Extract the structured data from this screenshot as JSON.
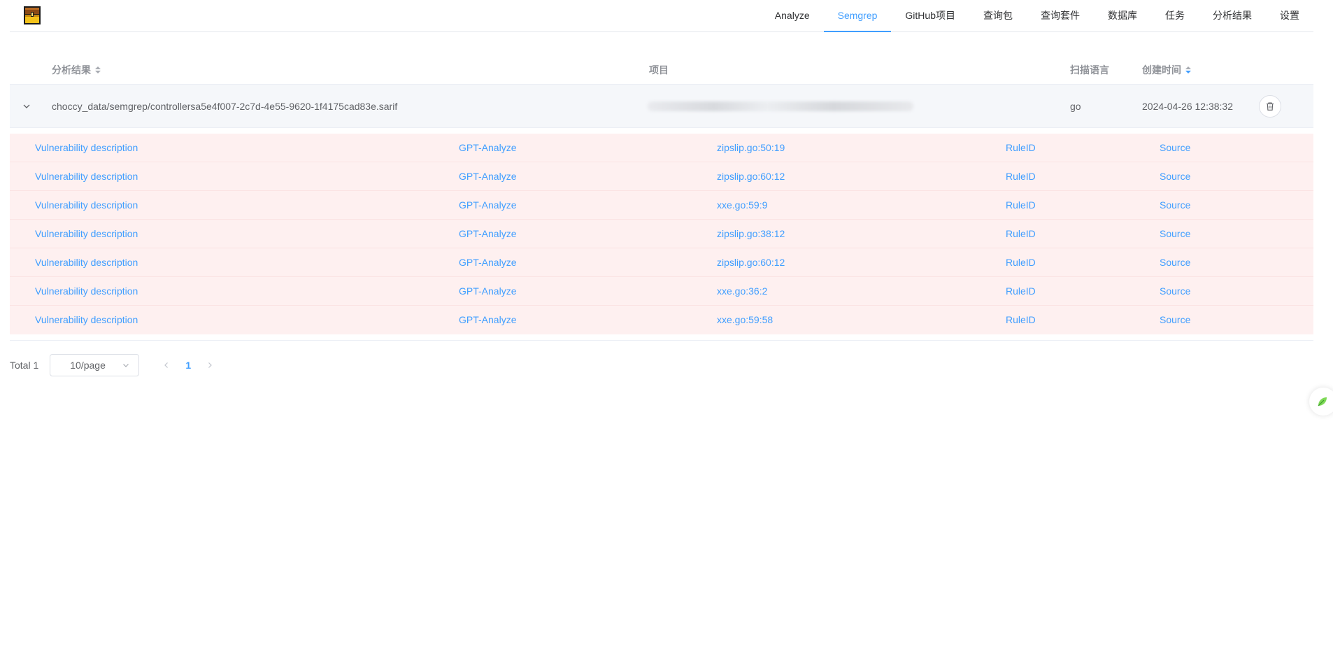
{
  "nav": {
    "items": [
      {
        "label": "Analyze",
        "active": false
      },
      {
        "label": "Semgrep",
        "active": true
      },
      {
        "label": "GitHub项目",
        "active": false
      },
      {
        "label": "查询包",
        "active": false
      },
      {
        "label": "查询套件",
        "active": false
      },
      {
        "label": "数据库",
        "active": false
      },
      {
        "label": "任务",
        "active": false
      },
      {
        "label": "分析结果",
        "active": false
      },
      {
        "label": "设置",
        "active": false
      }
    ]
  },
  "table": {
    "headers": {
      "result": "分析结果",
      "project": "项目",
      "language": "扫描语言",
      "created": "创建时间"
    },
    "rows": [
      {
        "result": "choccy_data/semgrep/controllersa5e4f007-2c7d-4e55-9620-1f4175cad83e.sarif",
        "language": "go",
        "created": "2024-04-26 12:38:32",
        "details": [
          {
            "desc": "Vulnerability description",
            "gpt": "GPT-Analyze",
            "location": "zipslip.go:50:19",
            "rule": "RuleID",
            "source": "Source"
          },
          {
            "desc": "Vulnerability description",
            "gpt": "GPT-Analyze",
            "location": "zipslip.go:60:12",
            "rule": "RuleID",
            "source": "Source"
          },
          {
            "desc": "Vulnerability description",
            "gpt": "GPT-Analyze",
            "location": "xxe.go:59:9",
            "rule": "RuleID",
            "source": "Source"
          },
          {
            "desc": "Vulnerability description",
            "gpt": "GPT-Analyze",
            "location": "zipslip.go:38:12",
            "rule": "RuleID",
            "source": "Source"
          },
          {
            "desc": "Vulnerability description",
            "gpt": "GPT-Analyze",
            "location": "zipslip.go:60:12",
            "rule": "RuleID",
            "source": "Source"
          },
          {
            "desc": "Vulnerability description",
            "gpt": "GPT-Analyze",
            "location": "xxe.go:36:2",
            "rule": "RuleID",
            "source": "Source"
          },
          {
            "desc": "Vulnerability description",
            "gpt": "GPT-Analyze",
            "location": "xxe.go:59:58",
            "rule": "RuleID",
            "source": "Source"
          }
        ]
      }
    ]
  },
  "pagination": {
    "total": "Total 1",
    "page_size": "10/page",
    "current_page": "1"
  },
  "colors": {
    "primary": "#409eff",
    "danger_row_bg": "#fef0f0",
    "header_text": "#909399"
  },
  "icons": {
    "logo": "treasure-chest-logo-icon",
    "expand": "chevron-down-icon",
    "delete": "trash-icon",
    "select": "chevron-down-icon",
    "prev": "chevron-left-icon",
    "next": "chevron-right-icon",
    "widget": "leaf-icon"
  }
}
